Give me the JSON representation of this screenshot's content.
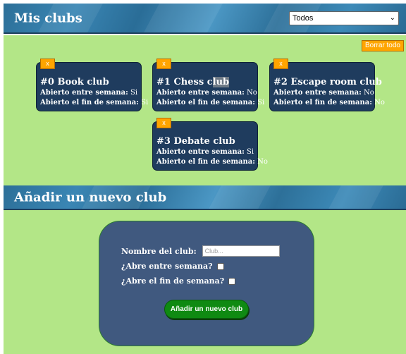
{
  "header": {
    "title": "Mis clubs",
    "filter": {
      "selected": "Todos"
    }
  },
  "actions": {
    "delete_all_label": "Borrar todo"
  },
  "clubs": [
    {
      "title": "#0 Book club",
      "remove_label": "x",
      "weekday_label": "Abierto entre semana:",
      "weekday_value": "Si",
      "weekend_label": "Abierto el fin de semana:",
      "weekend_value": "Si"
    },
    {
      "title_a": "#1 Chess c",
      "title_b": "lub",
      "remove_label": "x",
      "weekday_label": "Abierto entre semana:",
      "weekday_value": "No",
      "weekend_label": "Abierto el fin de semana:",
      "weekend_value": "Si"
    },
    {
      "title": "#2 Escape room club",
      "remove_label": "x",
      "weekday_label": "Abierto entre semana:",
      "weekday_value": "No",
      "weekend_label": "Abierto el fin de semana:",
      "weekend_value": "No"
    },
    {
      "title": "#3 Debate club",
      "remove_label": "x",
      "weekday_label": "Abierto entre semana:",
      "weekday_value": "Si",
      "weekend_label": "Abierto el fin de semana:",
      "weekend_value": "No"
    }
  ],
  "add_section": {
    "title": "Añadir un nuevo club",
    "name_label": "Nombre del club:",
    "name_placeholder": "Club...",
    "weekday_label": "¿Abre entre semana?",
    "weekend_label": "¿Abre el fin de semana?",
    "submit_label": "Añadir un nuevo club"
  },
  "colors": {
    "banner": "#3a86b4",
    "background": "#b3e687",
    "card": "#1f3c5e",
    "accent_orange": "#ffa500",
    "form_panel": "#40597f",
    "submit_green": "#0f8a12"
  },
  "icons": {
    "filter_dropdown": "chevron-down-icon"
  }
}
